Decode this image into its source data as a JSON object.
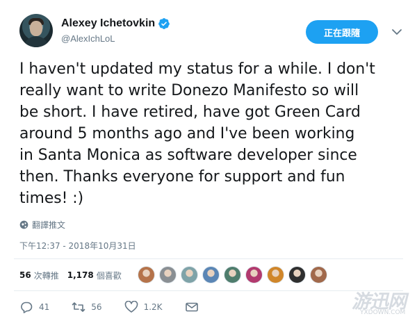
{
  "tweet": {
    "author": {
      "display_name": "Alexey Ichetovkin",
      "handle": "@AlexIchLoL",
      "verified": true
    },
    "follow_button_label": "正在跟隨",
    "text_lines": [
      "I haven't updated my status for a while. I don't",
      "really want to write Donezo Manifesto so will",
      "be short. I have retired, have got Green Card",
      "around 5 months ago and I've been working",
      "in Santa Monica as software developer since",
      "then. Thanks everyone for support and fun",
      "times! :)"
    ],
    "translate_label": "翻譯推文",
    "timestamp": "下午12:37 - 2018年10月31日",
    "stats": {
      "retweets_count": "56",
      "retweets_label": "次轉推",
      "likes_count": "1,178",
      "likes_label": "個喜歡"
    },
    "actions": {
      "replies": "41",
      "retweets": "56",
      "likes": "1.2K"
    },
    "liker_avatars": [
      {
        "color": "#b5734a"
      },
      {
        "color": "#8a8f93"
      },
      {
        "color": "#7fa3a8"
      },
      {
        "color": "#5b86b5"
      },
      {
        "color": "#4f7d6d"
      },
      {
        "color": "#b23a6e"
      },
      {
        "color": "#d0862a"
      },
      {
        "color": "#2f2f2f"
      },
      {
        "color": "#a1694b"
      }
    ],
    "colors": {
      "accent": "#1da1f2",
      "text": "#14171a",
      "secondary_text": "#657786"
    }
  },
  "watermark": {
    "main": "游迅网",
    "sub": "YXDOWN.COM"
  }
}
